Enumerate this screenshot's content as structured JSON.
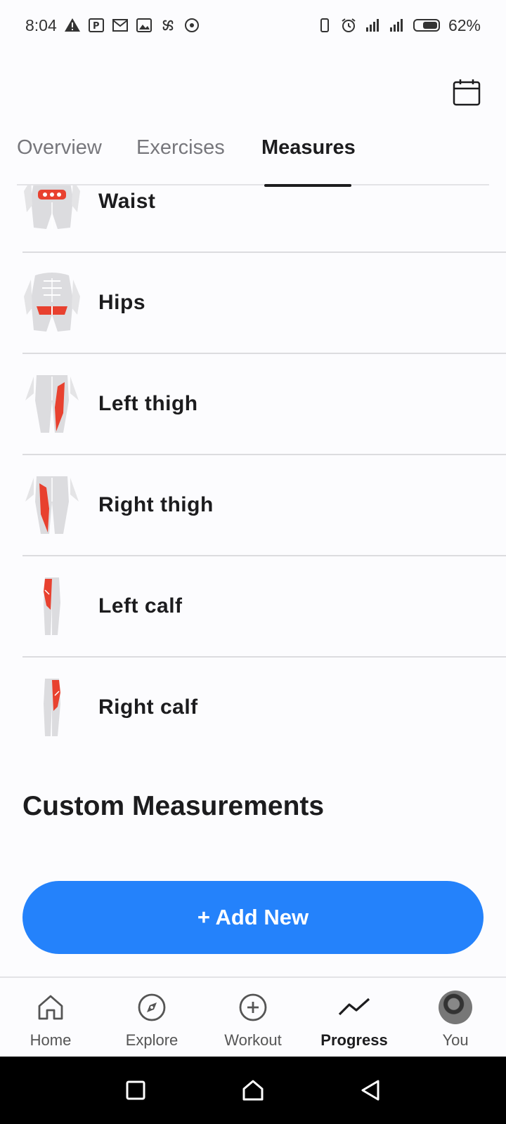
{
  "status_bar": {
    "time": "8:04",
    "battery": "62%",
    "left_icons": [
      "warning-icon",
      "parking-icon",
      "mail-icon",
      "image-icon",
      "pinwheel-icon",
      "target-icon"
    ],
    "right_icons": [
      "vibrate-icon",
      "alarm-icon",
      "signal-icon",
      "signal-icon",
      "battery-icon"
    ]
  },
  "header": {
    "calendar_icon": "calendar-icon",
    "tabs": [
      {
        "label": "Overview"
      },
      {
        "label": "Exercises"
      },
      {
        "label": "Measures",
        "active": true
      }
    ]
  },
  "measures": [
    {
      "label": "Waist",
      "icon": "waist-muscle-icon"
    },
    {
      "label": "Hips",
      "icon": "hips-muscle-icon"
    },
    {
      "label": "Left thigh",
      "icon": "left-thigh-muscle-icon"
    },
    {
      "label": "Right thigh",
      "icon": "right-thigh-muscle-icon"
    },
    {
      "label": "Left calf",
      "icon": "left-calf-muscle-icon"
    },
    {
      "label": "Right calf",
      "icon": "right-calf-muscle-icon"
    }
  ],
  "custom_section": {
    "title": "Custom Measurements",
    "add_button": "+ Add New"
  },
  "accent_color": "#2482fb",
  "highlight_color": "#e8412f",
  "bottom_nav": [
    {
      "label": "Home",
      "icon": "home-icon"
    },
    {
      "label": "Explore",
      "icon": "compass-icon"
    },
    {
      "label": "Workout",
      "icon": "plus-circle-icon"
    },
    {
      "label": "Progress",
      "icon": "trend-icon",
      "active": true
    },
    {
      "label": "You",
      "icon": "avatar"
    }
  ],
  "system_nav": [
    "recents-icon",
    "home-icon",
    "back-icon"
  ]
}
